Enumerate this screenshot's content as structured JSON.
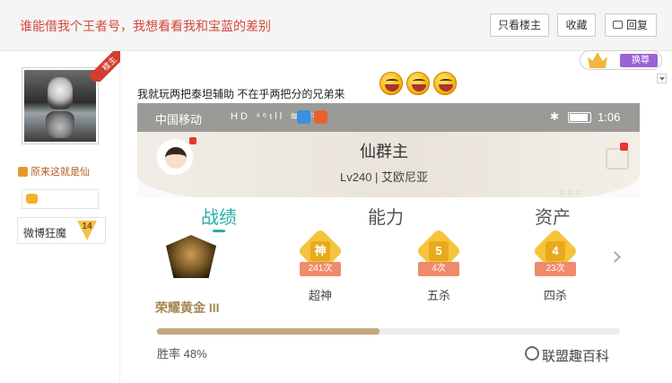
{
  "header": {
    "title": "谁能借我个王者号，我想看看我和宝蓝的差别",
    "btn_only_op": "只看楼主",
    "btn_collect": "收藏",
    "btn_reply": "回复"
  },
  "user": {
    "ribbon": "楼主",
    "honor": "原来这就是仙",
    "weibo_name": "微博狂魔",
    "level": "14"
  },
  "swap_badge": {
    "label": "换尊"
  },
  "post": {
    "text": "我就玩两把泰坦辅助 不在乎两把分的兄弟来"
  },
  "screenshot": {
    "status": {
      "carrier": "中国移动",
      "icons": "HD ⁴⁶ıll ≋ ⚐",
      "bt": "✱",
      "time": "1:06"
    },
    "profile": {
      "name": "仙群主",
      "sub": "Lv240 | 艾欧尼亚"
    },
    "tabs": [
      "战绩",
      "能力",
      "资产"
    ],
    "rank": "荣耀黄金 III",
    "medals": [
      {
        "glyph": "神",
        "count": "241次",
        "label": "超神"
      },
      {
        "glyph": "5",
        "count": "4次",
        "label": "五杀"
      },
      {
        "glyph": "4",
        "count": "23次",
        "label": "四杀"
      }
    ],
    "winrate_label": "胜率",
    "winrate_value": "48%",
    "winrate_fraction": 0.48
  },
  "watermark": "联盟趣百科",
  "colors": {
    "accent_red": "#d24a3c",
    "teal": "#2aaea4",
    "gold": "#c3a57d"
  }
}
